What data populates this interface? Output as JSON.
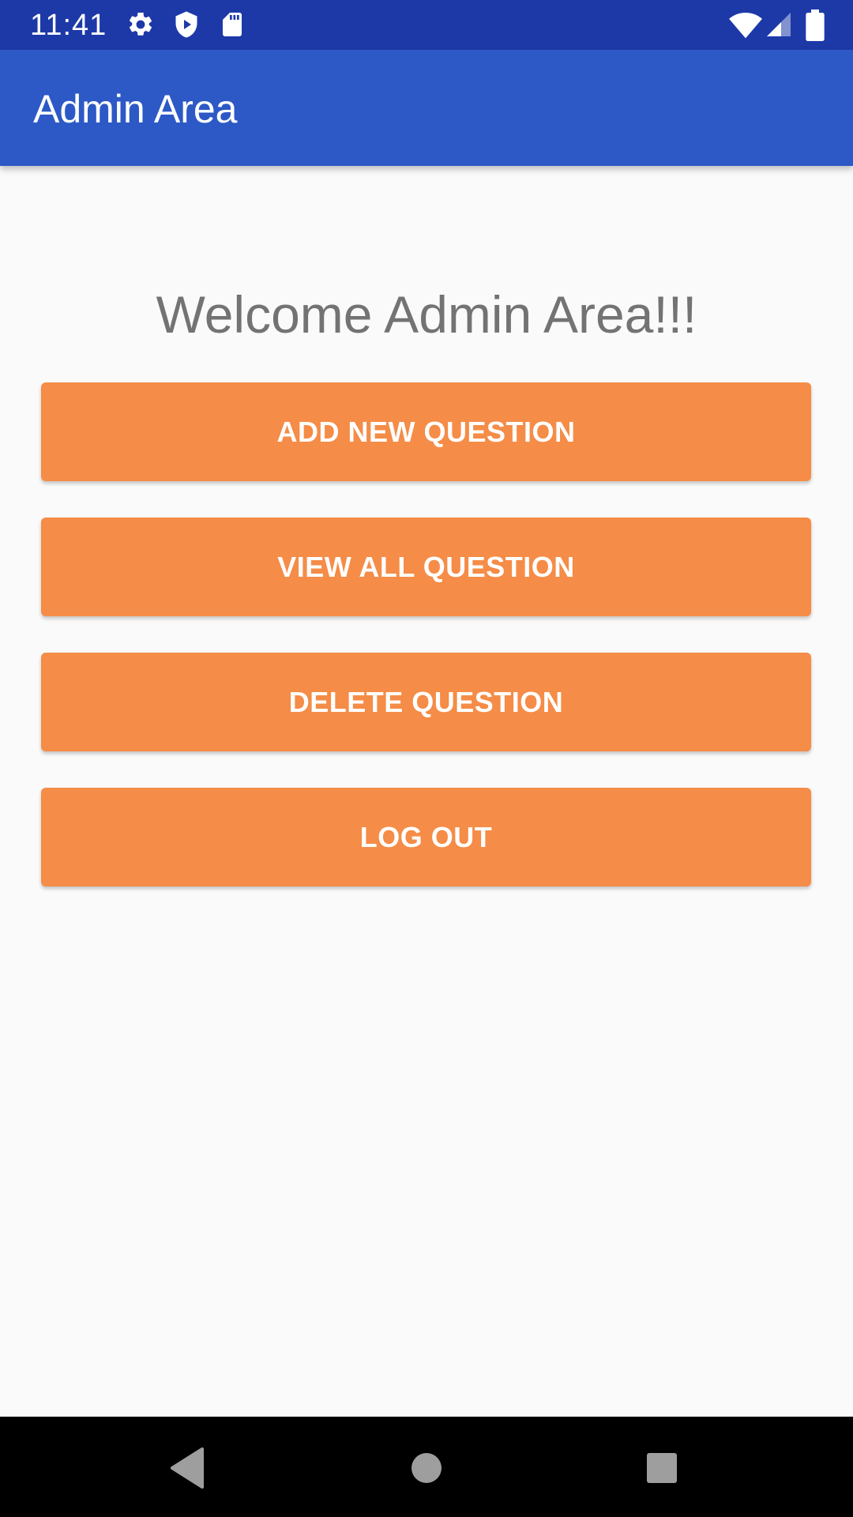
{
  "status_bar": {
    "time": "11:41",
    "left_icons": [
      "gear-icon",
      "shield-icon",
      "sd-card-icon"
    ],
    "right_icons": [
      "wifi-icon",
      "cell-signal-icon",
      "battery-icon"
    ]
  },
  "app_bar": {
    "title": "Admin Area"
  },
  "main": {
    "welcome_text": "Welcome Admin Area!!!",
    "buttons": [
      {
        "label": "ADD NEW QUESTION"
      },
      {
        "label": "VIEW ALL QUESTION"
      },
      {
        "label": "DELETE QUESTION"
      },
      {
        "label": "LOG OUT"
      }
    ]
  },
  "nav_bar": {
    "buttons": [
      "back-icon",
      "home-icon",
      "recents-icon"
    ]
  },
  "colors": {
    "status_bar": "#1d39a8",
    "app_bar": "#2c59c6",
    "button": "#f58c47",
    "background": "#fafafa",
    "welcome_text": "#737373"
  }
}
